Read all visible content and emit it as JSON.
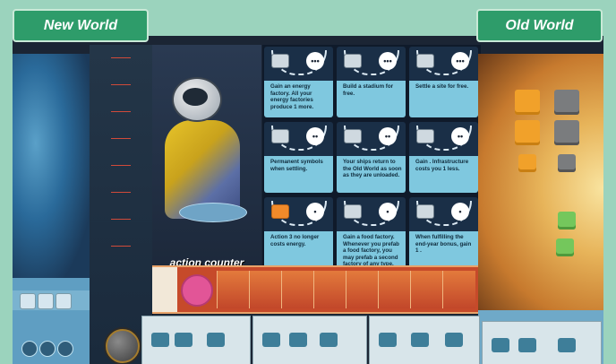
{
  "headers": {
    "left": "New World",
    "right": "Old World"
  },
  "astronaut": {
    "caption": "action counter"
  },
  "cards": [
    {
      "cost": "•••",
      "text": "Gain an energy factory. All your energy factories produce 1 more."
    },
    {
      "cost": "•••",
      "text": "Build a stadium for free."
    },
    {
      "cost": "•••",
      "text": "Settle a site for free."
    },
    {
      "cost": "••",
      "text": "Permanent symbols when settling."
    },
    {
      "cost": "••",
      "text": "Your ships return to the Old World as soon as they are unloaded."
    },
    {
      "cost": "••",
      "text": "Gain . Infrastructure costs you 1 less."
    },
    {
      "cost": "•",
      "text": "Action 3 no longer costs energy."
    },
    {
      "cost": "•",
      "text": "Gain a food factory. Whenever you prefab a food factory, you may prefab a second factory of any type."
    },
    {
      "cost": "•",
      "text": "When fulfilling the end-year bonus, gain 1 ."
    }
  ],
  "colors": {
    "background": "#9bd3bd",
    "tag": "#2e9c6a",
    "card_text_panel": "#7fc8df",
    "pink_disc": "#e25597"
  },
  "icons": {
    "energy": "lightning-icon",
    "factory": "factory-icon",
    "stadium": "stadium-icon"
  }
}
